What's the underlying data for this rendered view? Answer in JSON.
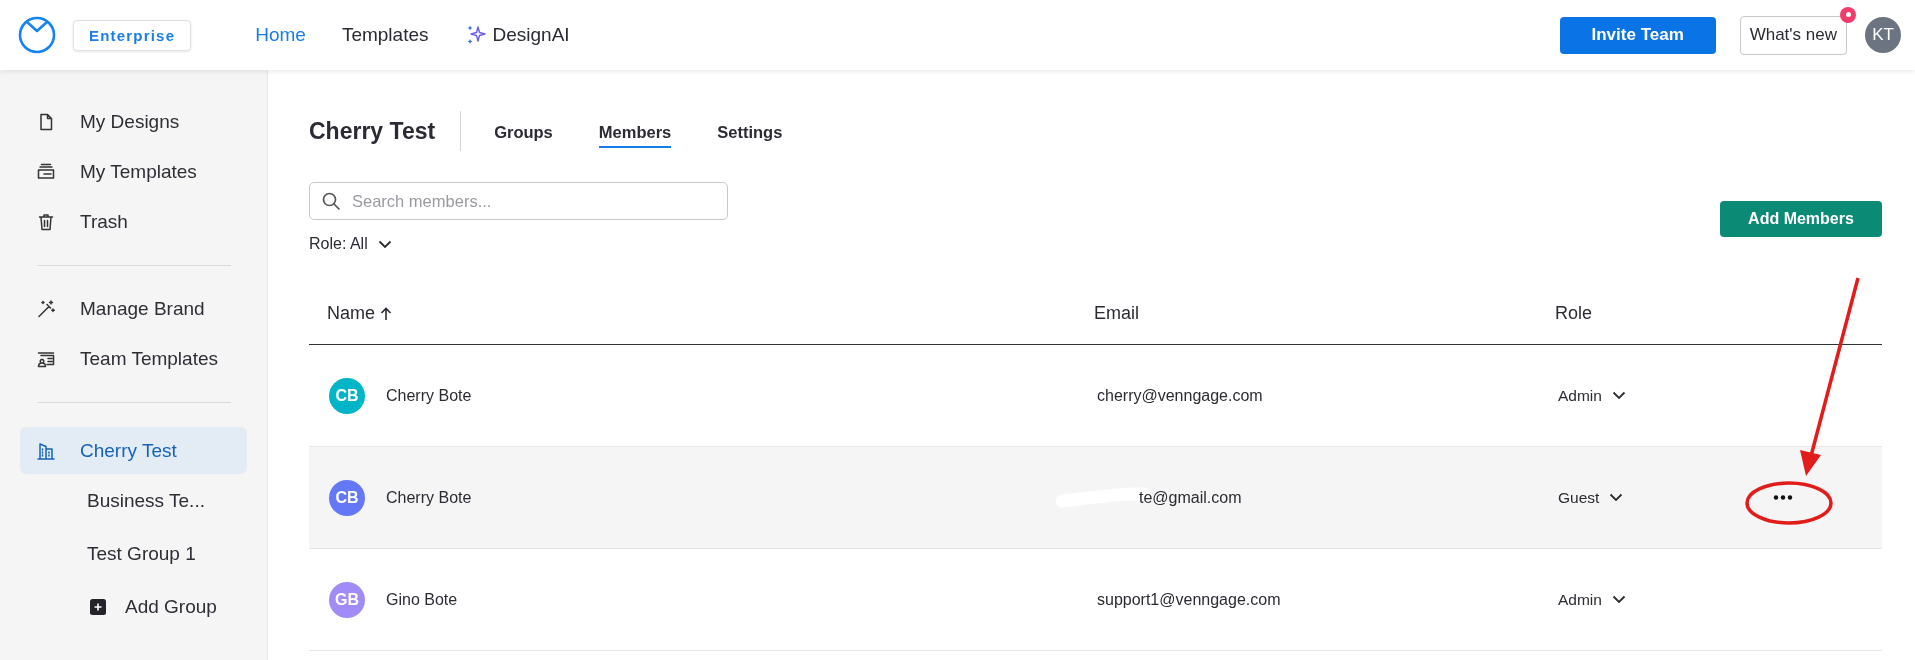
{
  "header": {
    "badge": "Enterprise",
    "nav": [
      {
        "label": "Home",
        "selected": true,
        "kind": "link"
      },
      {
        "label": "Templates",
        "selected": false,
        "kind": "link"
      },
      {
        "label": "DesignAI",
        "selected": false,
        "kind": "ai"
      }
    ],
    "invite_button": "Invite Team",
    "whats_new": {
      "label": "What's new",
      "notification": true
    },
    "avatar": "KT"
  },
  "sidebar": {
    "sections": [
      {
        "items": [
          {
            "label": "My Designs",
            "selected": false
          },
          {
            "label": "My Templates",
            "selected": false
          },
          {
            "label": "Trash",
            "selected": false
          }
        ]
      },
      {
        "items": [
          {
            "label": "Manage Brand",
            "selected": false
          },
          {
            "label": "Team Templates",
            "selected": false
          }
        ]
      },
      {
        "items": [
          {
            "label": "Cherry Test",
            "selected": true,
            "children": [
              {
                "label": "Business Te...",
                "kind": "group",
                "selected": false
              },
              {
                "label": "Test Group 1",
                "kind": "group",
                "selected": false
              },
              {
                "label": "Add Group",
                "kind": "add",
                "selected": false
              }
            ]
          }
        ]
      }
    ]
  },
  "team": {
    "title": "Cherry Test",
    "tabs": [
      {
        "label": "Groups",
        "selected": false
      },
      {
        "label": "Members",
        "selected": true
      },
      {
        "label": "Settings",
        "selected": false
      }
    ],
    "search": {
      "placeholder": "Search members..."
    },
    "role_filter": "Role: All",
    "add_button": "Add Members",
    "table": {
      "columns": [
        {
          "label": "Name",
          "sorted": true
        },
        {
          "label": "Email",
          "sorted": false
        },
        {
          "label": "Role",
          "sorted": false
        }
      ],
      "rows": [
        {
          "initials": "CB",
          "color": "#00b5c8",
          "name": "Cherry Bote",
          "email": "cherry@venngage.com",
          "redacted": false,
          "role": "Admin",
          "hovered": false
        },
        {
          "initials": "CB",
          "color": "#6478f7",
          "name": "Cherry Bote",
          "email": "te@gmail.com",
          "redacted": true,
          "role": "Guest",
          "hovered": true
        },
        {
          "initials": "GB",
          "color": "#a18cf7",
          "name": "Gino Bote",
          "email": "support1@venngage.com",
          "redacted": false,
          "role": "Admin",
          "hovered": false
        }
      ]
    }
  },
  "annotations": {
    "arrow": true,
    "circle": true
  }
}
